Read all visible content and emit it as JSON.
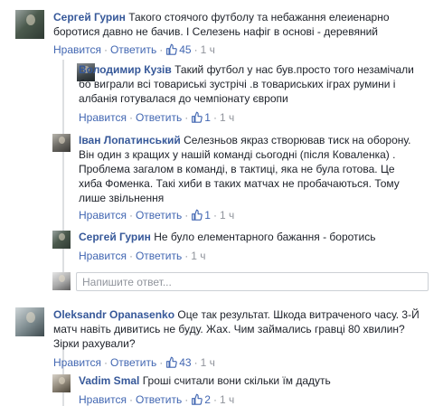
{
  "like_label": "Нравится",
  "reply_label": "Ответить",
  "dot": "·",
  "reply_placeholder": "Напишите ответ...",
  "comments": [
    {
      "author": "Сергей Гурин",
      "text_lines": [
        "Такого стоячого футболу та небажання елеиенарно",
        "боротися давно не бачив. І Селезень нафіг в основі - деревяний"
      ],
      "likes": "45",
      "time": "1 ч"
    },
    {
      "author": "Володимир Кузів",
      "text_lines": [
        "Такий футбол у нас був.просто того незамічали",
        "бо виграли всі товариські зустрічі .в товариських іграх румини і",
        "албанія готувалася до чемпіонату європи"
      ],
      "likes": "1",
      "time": "1 ч"
    },
    {
      "author": "Іван Лопатинський",
      "text_lines": [
        "Селезньов якраз створював тиск на оборону.",
        "Він один з кращих у нашій команді сьогодні (після Коваленка) .",
        "Проблема загалом в команді, в тактиці, яка не була готова. Це",
        "хиба Фоменка. Такі хиби в таких матчах не пробачаються. Тому",
        "лише звільнення"
      ],
      "likes": "1",
      "time": "1 ч"
    },
    {
      "author": "Сергей Гурин",
      "text_lines": [
        "Не було елементарного бажання - боротись"
      ],
      "likes": "",
      "time": "1 ч"
    },
    {
      "author": "Oleksandr Opanasenko",
      "text_lines": [
        "Оце так результат. Шкода витраченого часу. 3-Й",
        "матч навіть дивитись не буду. Жах. Чим займались гравці 80 хвилин?",
        "Зірки рахували?"
      ],
      "likes": "43",
      "time": "1 ч"
    },
    {
      "author": "Vadim Smal",
      "text_lines": [
        "Гроші считали вони скільки їм дадуть"
      ],
      "likes": "2",
      "time": "1 ч"
    }
  ]
}
